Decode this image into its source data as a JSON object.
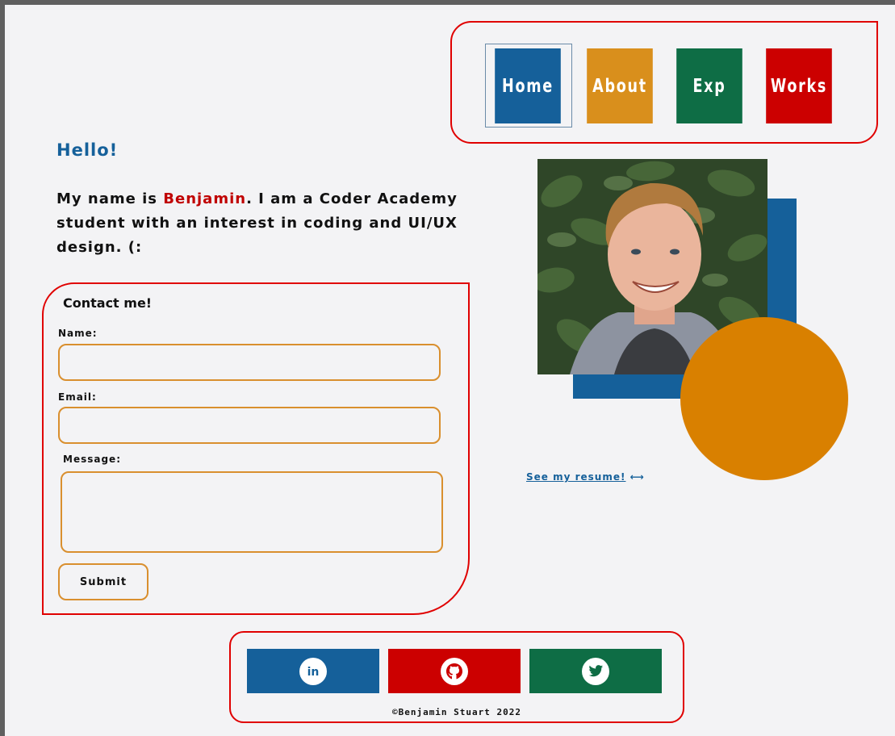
{
  "nav": {
    "items": [
      {
        "label": "Home",
        "color": "#15609a"
      },
      {
        "label": "About",
        "color": "#d98f1c"
      },
      {
        "label": "Exp",
        "color": "#0e6d45"
      },
      {
        "label": "Works",
        "color": "#cc0000"
      }
    ]
  },
  "hero": {
    "greeting": "Hello!",
    "intro_prefix": "My name is ",
    "intro_name": "Benjamin",
    "intro_suffix": ". I am a Coder Academy student with an interest in coding and UI/UX design. (:"
  },
  "contact": {
    "title": "Contact me!",
    "name_label": "Name:",
    "email_label": "Email:",
    "message_label": "Message:",
    "name_value": "",
    "email_value": "",
    "message_value": "",
    "submit_label": "Submit"
  },
  "resume": {
    "link_text": "See my resume!",
    "arrow": "⟷"
  },
  "footer": {
    "socials": [
      {
        "name": "linkedin",
        "icon": "linkedin-icon",
        "color": "#15609a"
      },
      {
        "name": "github",
        "icon": "github-icon",
        "color": "#cc0000"
      },
      {
        "name": "twitter",
        "icon": "twitter-icon",
        "color": "#0e6d45"
      }
    ],
    "copyright": "©Benjamin Stuart 2022"
  },
  "colors": {
    "accent_blue": "#15609a",
    "accent_orange": "#d98000",
    "accent_red": "#cc0000",
    "accent_green": "#0e6d45",
    "border_red": "#e00000"
  }
}
